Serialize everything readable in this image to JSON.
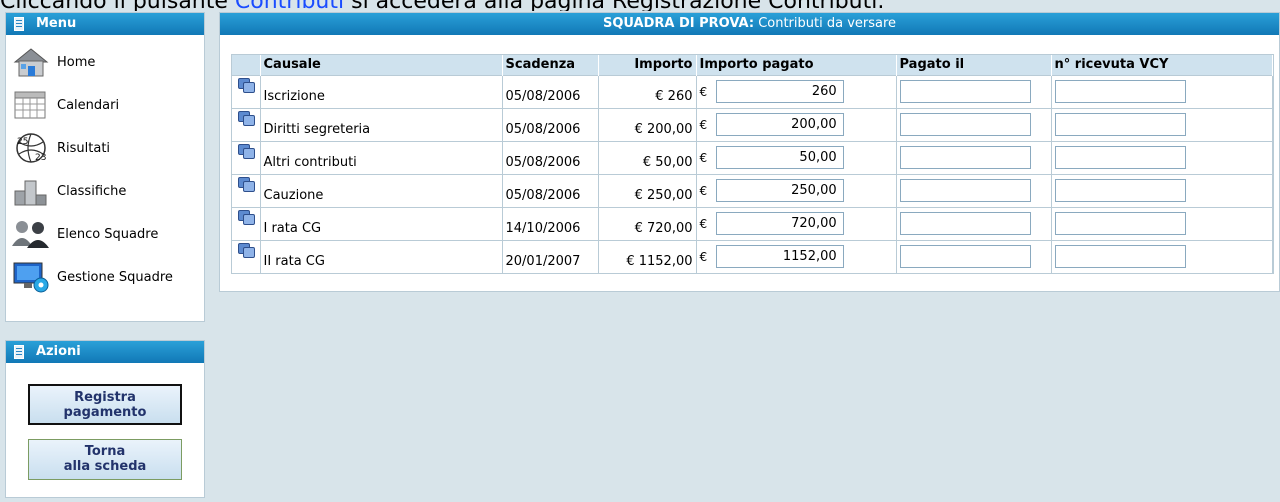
{
  "caption": {
    "prefix": "Cliccando il pulsante",
    "link": "Contributi",
    "suffix": "si accederà alla pagina Registrazione Contributi."
  },
  "sidebar": {
    "menu_title": "Menu",
    "items": [
      {
        "label": "Home",
        "icon": "house-icon"
      },
      {
        "label": "Calendari",
        "icon": "calendar-icon"
      },
      {
        "label": "Risultati",
        "icon": "ball-icon"
      },
      {
        "label": "Classifiche",
        "icon": "podium-icon"
      },
      {
        "label": "Elenco Squadre",
        "icon": "people-icon"
      },
      {
        "label": "Gestione Squadre",
        "icon": "monitor-gear-icon"
      }
    ],
    "actions_title": "Azioni",
    "actions": [
      {
        "line1": "Registra",
        "line2": "pagamento"
      },
      {
        "line1": "Torna",
        "line2": "alla scheda"
      }
    ]
  },
  "main": {
    "header_team": "SQUADRA DI PROVA:",
    "header_title": "Contributi da versare",
    "columns": [
      "Causale",
      "Scadenza",
      "Importo",
      "Importo pagato",
      "Pagato il",
      "n° ricevuta VCY"
    ],
    "currency": "€",
    "rows": [
      {
        "causale": "Iscrizione",
        "scadenza": "05/08/2006",
        "importo": "€ 260",
        "pagato": "260",
        "pagato_il": "",
        "ricevuta": ""
      },
      {
        "causale": "Diritti segreteria",
        "scadenza": "05/08/2006",
        "importo": "€ 200,00",
        "pagato": "200,00",
        "pagato_il": "",
        "ricevuta": ""
      },
      {
        "causale": "Altri contributi",
        "scadenza": "05/08/2006",
        "importo": "€ 50,00",
        "pagato": "50,00",
        "pagato_il": "",
        "ricevuta": ""
      },
      {
        "causale": "Cauzione",
        "scadenza": "05/08/2006",
        "importo": "€ 250,00",
        "pagato": "250,00",
        "pagato_il": "",
        "ricevuta": ""
      },
      {
        "causale": "I rata CG",
        "scadenza": "14/10/2006",
        "importo": "€ 720,00",
        "pagato": "720,00",
        "pagato_il": "",
        "ricevuta": ""
      },
      {
        "causale": "II rata CG",
        "scadenza": "20/01/2007",
        "importo": "€ 1152,00",
        "pagato": "1152,00",
        "pagato_il": "",
        "ricevuta": ""
      }
    ]
  }
}
